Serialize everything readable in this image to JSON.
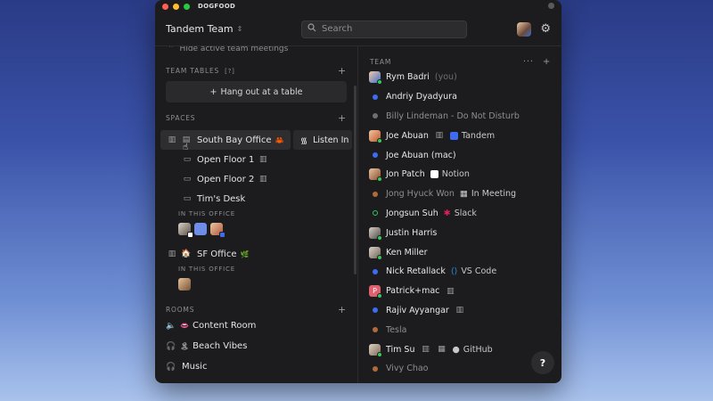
{
  "window": {
    "app_name": "DOGFOOD"
  },
  "header": {
    "team_name": "Tandem Team",
    "search_placeholder": "Search"
  },
  "left": {
    "faded_top": "Hide active team meetings",
    "team_tables": {
      "label": "TEAM TABLES",
      "badge": "[?]",
      "hangout_label": "Hang out at a table"
    },
    "spaces": {
      "label": "SPACES",
      "south_bay": {
        "name": "South Bay Office",
        "emoji": "🦀",
        "listen_label": "Listen In"
      },
      "rooms": [
        {
          "name": "Open Floor 1"
        },
        {
          "name": "Open Floor 2"
        },
        {
          "name": "Tim's Desk"
        }
      ],
      "in_office_label": "IN THIS OFFICE",
      "sf": {
        "name": "SF Office",
        "emoji": "🌿"
      },
      "in_office_label_2": "IN THIS OFFICE"
    },
    "rooms": {
      "label": "ROOMS",
      "items": [
        {
          "name": "Content Room",
          "emoji": "👄"
        },
        {
          "name": "Beach Vibes",
          "emoji": "🏝"
        },
        {
          "name": "Music",
          "emoji": ""
        }
      ]
    }
  },
  "team": {
    "label": "TEAM",
    "members": [
      {
        "name": "Rym Badri",
        "suffix": "(you)"
      },
      {
        "name": "Andriy Dyadyura"
      },
      {
        "name": "Billy Lindeman - Do Not Disturb"
      },
      {
        "name": "Joe Abuan",
        "app": "Tandem"
      },
      {
        "name": "Joe Abuan (mac)"
      },
      {
        "name": "Jon Patch",
        "app": "Notion"
      },
      {
        "name": "Jong Hyuck Won",
        "app": "In Meeting"
      },
      {
        "name": "Jongsun Suh",
        "app": "Slack"
      },
      {
        "name": "Justin Harris"
      },
      {
        "name": "Ken Miller"
      },
      {
        "name": "Nick Retallack",
        "app": "VS Code"
      },
      {
        "name": "Patrick+mac"
      },
      {
        "name": "Rajiv Ayyangar"
      },
      {
        "name": "Tesla"
      },
      {
        "name": "Tim Su",
        "app": "GitHub"
      },
      {
        "name": "Vivy Chao"
      }
    ]
  },
  "help_label": "?",
  "colors": {
    "online": "#34c759",
    "away": "#3d6cf2",
    "idle": "#b06a3b",
    "dnd": "#6e6e73"
  }
}
